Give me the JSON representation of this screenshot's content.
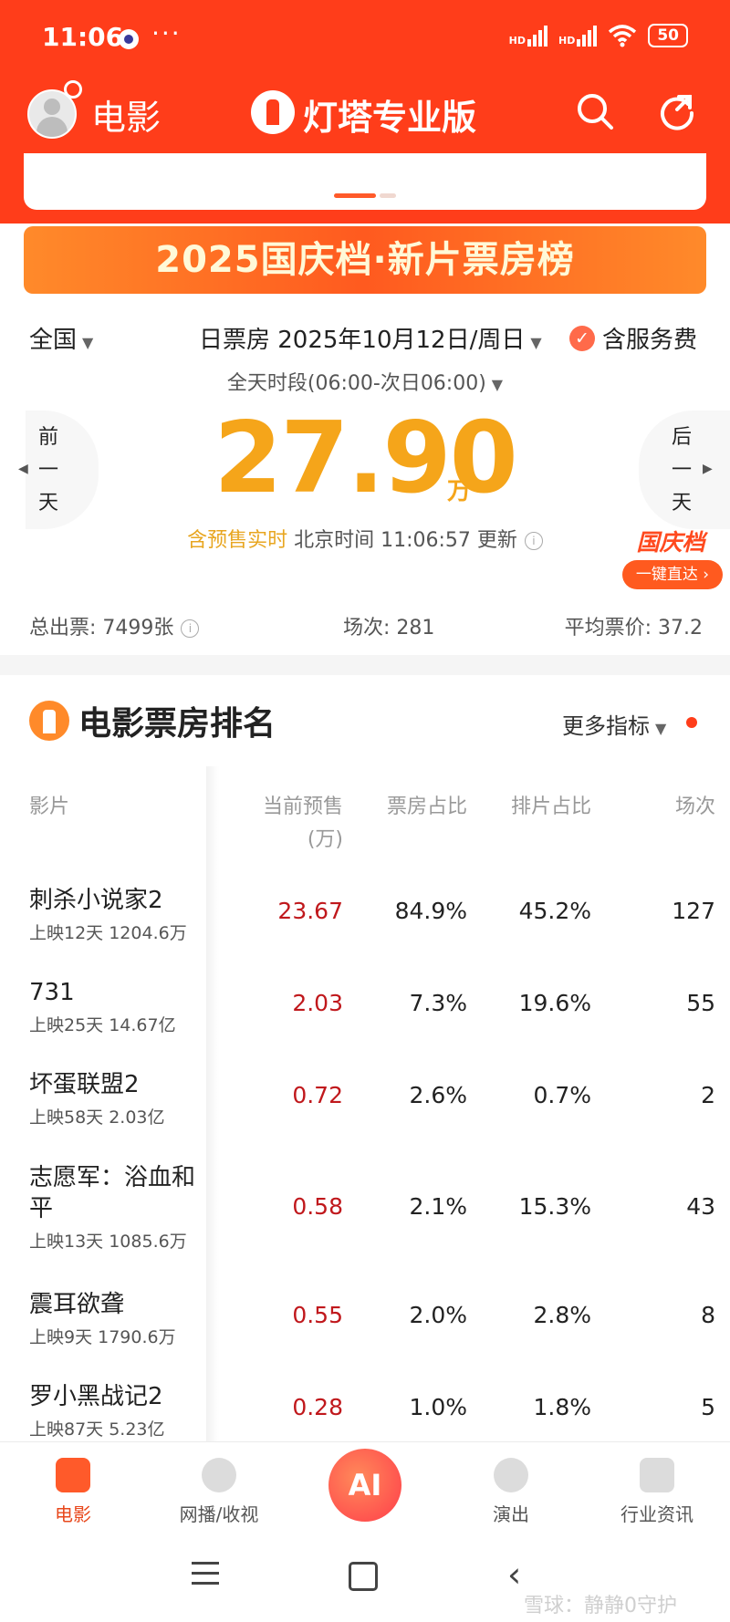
{
  "status_bar": {
    "time": "11:06",
    "more": "···",
    "battery": "50",
    "net1": "HD",
    "net2": "HD"
  },
  "header": {
    "section": "电影",
    "brand": "灯塔专业版"
  },
  "banner": {
    "text": "2025国庆档·新片票房榜"
  },
  "filters": {
    "region": "全国",
    "date": "日票房 2025年10月12日/周日",
    "service_fee": "含服务费",
    "time_range": "全天时段(06:00-次日06:00)"
  },
  "day_nav": {
    "prev": [
      "前",
      "一",
      "天"
    ],
    "next": [
      "后",
      "一",
      "天"
    ]
  },
  "box_office": {
    "value": "27.90",
    "unit": "万",
    "live_label": "含预售实时",
    "update_time": "北京时间 11:06:57 更新"
  },
  "holiday": {
    "tag": "国庆档",
    "button": "一键直达 ›"
  },
  "stats": {
    "tickets": "总出票: 7499张",
    "shows": "场次: 281",
    "avg_price": "平均票价: 37.2"
  },
  "ranking": {
    "title": "电影票房排名",
    "more": "更多指标",
    "columns": {
      "film": "影片",
      "presale": "当前预售",
      "presale_unit": "(万)",
      "box_share": "票房占比",
      "schedule_share": "排片占比",
      "shows": "场次"
    },
    "rows": [
      {
        "name": "刺杀小说家2",
        "sub": "上映12天 1204.6万",
        "presale": "23.67",
        "box_share": "84.9%",
        "schedule_share": "45.2%",
        "shows": "127"
      },
      {
        "name": "731",
        "sub": "上映25天 14.67亿",
        "presale": "2.03",
        "box_share": "7.3%",
        "schedule_share": "19.6%",
        "shows": "55"
      },
      {
        "name": "坏蛋联盟2",
        "sub": "上映58天 2.03亿",
        "presale": "0.72",
        "box_share": "2.6%",
        "schedule_share": "0.7%",
        "shows": "2"
      },
      {
        "name": "志愿军：浴血和平",
        "sub": "上映13天 1085.6万",
        "presale": "0.58",
        "box_share": "2.1%",
        "schedule_share": "15.3%",
        "shows": "43"
      },
      {
        "name": "震耳欲聋",
        "sub": "上映9天 1790.6万",
        "presale": "0.55",
        "box_share": "2.0%",
        "schedule_share": "2.8%",
        "shows": "8"
      },
      {
        "name": "罗小黑战记2",
        "sub": "上映87天 5.23亿",
        "presale": "0.28",
        "box_share": "1.0%",
        "schedule_share": "1.8%",
        "shows": "5"
      }
    ]
  },
  "bottom_nav": {
    "items": [
      "电影",
      "网播/收视",
      "演出",
      "行业资讯"
    ],
    "ai": "AI"
  },
  "watermark": "雪球：静静0守护",
  "colors": {
    "brand": "#ff3d1a",
    "highlight": "#f5a51a",
    "presale": "#c0181c"
  }
}
